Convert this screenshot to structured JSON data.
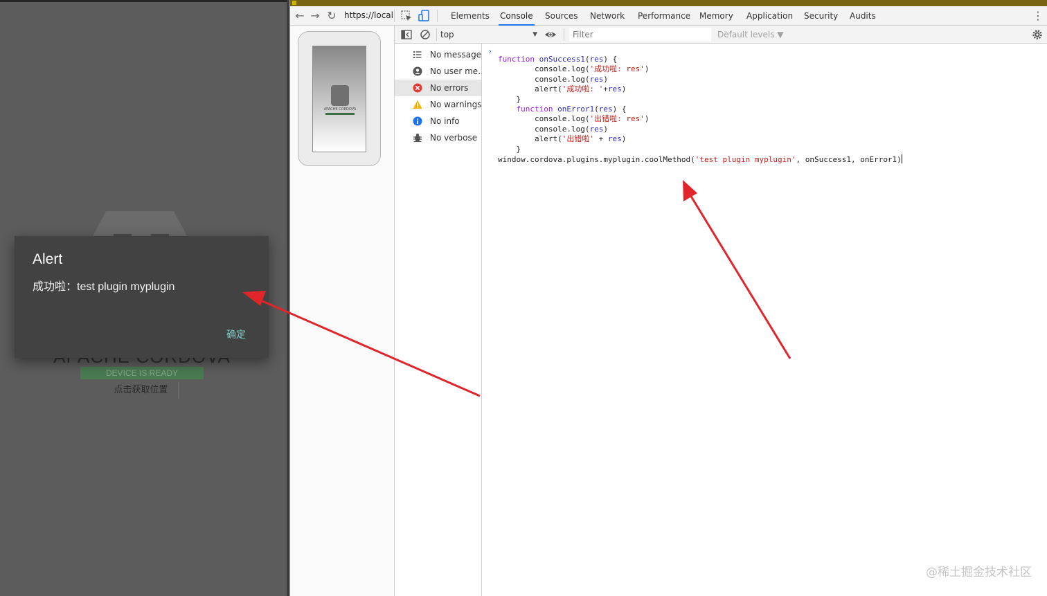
{
  "device": {
    "app_title": "APACHE CORDOVA",
    "ready_badge": "DEVICE IS READY",
    "locate_button": "点击获取位置",
    "alert": {
      "title": "Alert",
      "message": "成功啦：test plugin myplugin",
      "ok_label": "确定"
    }
  },
  "devtools": {
    "url": "https://local",
    "tabs": [
      "Elements",
      "Console",
      "Sources",
      "Network",
      "Performance",
      "Memory",
      "Application",
      "Security",
      "Audits"
    ],
    "active_tab": "Console",
    "console_toolbar": {
      "context": "top",
      "filter_placeholder": "Filter",
      "levels_label": "Default levels ▼"
    },
    "sidebar": [
      {
        "label": "No messages",
        "icon": "list-icon"
      },
      {
        "label": "No user me…",
        "icon": "user-icon"
      },
      {
        "label": "No errors",
        "icon": "error-icon",
        "selected": true
      },
      {
        "label": "No warnings",
        "icon": "warning-icon"
      },
      {
        "label": "No info",
        "icon": "info-icon"
      },
      {
        "label": "No verbose",
        "icon": "bug-icon"
      }
    ],
    "prompt_symbol": "›"
  },
  "colors": {
    "accent": "#1a73e8",
    "annotation_arrow": "#e0252b",
    "alert_background": "#424242",
    "alert_ok": "#80cbc4"
  },
  "watermark": "@稀土掘金技术社区"
}
